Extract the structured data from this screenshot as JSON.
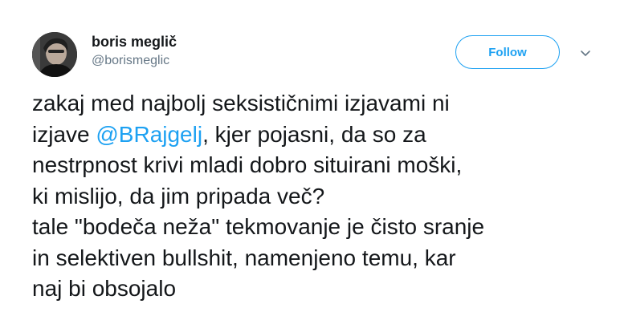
{
  "author": {
    "display_name": "boris meglič",
    "handle": "@borismeglic"
  },
  "actions": {
    "follow_label": "Follow",
    "menu_icon": "chevron-down-icon"
  },
  "tweet": {
    "line1": "zakaj med najbolj seksističnimi izjavami ni",
    "line2_prefix": "izjave ",
    "line2_mention": "@BRajgelj",
    "line2_suffix": ", kjer pojasni, da so za",
    "line3": "nestrpnost krivi mladi dobro situirani moški,",
    "line4": "ki mislijo, da jim pripada več?",
    "line5": "tale \"bodeča neža\" tekmovanje je čisto sranje",
    "line6": "in selektiven bullshit, namenjeno temu, kar",
    "line7": "naj bi obsojalo"
  },
  "colors": {
    "accent": "#1da1f2",
    "text": "#14171a",
    "secondary": "#657786"
  }
}
